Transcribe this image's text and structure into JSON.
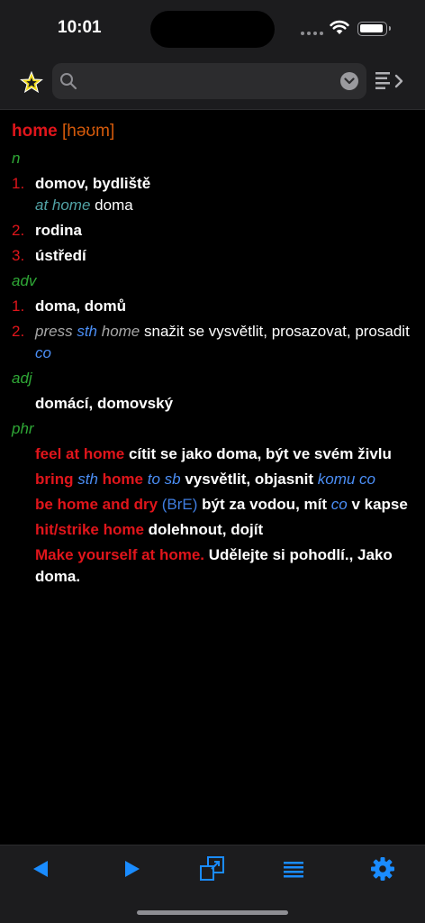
{
  "status": {
    "time": "10:01"
  },
  "search": {
    "placeholder": "",
    "value": ""
  },
  "entry": {
    "headword": "home",
    "pronunciation": "[həʊm]",
    "noun": {
      "pos": "n",
      "senses": [
        {
          "num": "1.",
          "translation": "domov, bydliště",
          "example": "at home",
          "example_translation": "doma"
        },
        {
          "num": "2.",
          "translation": "rodina"
        },
        {
          "num": "3.",
          "translation": "ústředí"
        }
      ]
    },
    "adverb": {
      "pos": "adv",
      "sense1": {
        "num": "1.",
        "translation": "doma, domů"
      },
      "sense2": {
        "num": "2.",
        "press": "press",
        "sth": "sth",
        "home": "home",
        "translation": "snažit se vysvětlit, prosazovat, prosadit",
        "co": "co"
      }
    },
    "adjective": {
      "pos": "adj",
      "translation": "domácí, domovský"
    },
    "phrases": {
      "pos": "phr",
      "p1": {
        "phrase": "feel at home",
        "translation": "cítit se jako doma, být ve svém živlu"
      },
      "p2": {
        "bring": "bring",
        "sth": "sth",
        "home": "home",
        "to_sb": "to sb",
        "translation": "vysvětlit, objasnit",
        "komu": "komu",
        "co": "co"
      },
      "p3": {
        "phrase": "be home and dry",
        "region": "(BrE)",
        "translation_a": "být za vodou, mít",
        "co": "co",
        "translation_b": "v kapse"
      },
      "p4": {
        "phrase": "hit/strike home",
        "translation": "dolehnout, dojít"
      },
      "p5": {
        "phrase": "Make yourself at home.",
        "translation": "Udělejte si pohodlí., Jako doma."
      }
    }
  },
  "colors": {
    "headword": "#e0151b",
    "pronunciation": "#d55a0b",
    "pos": "#2fa836",
    "example": "#52a3a6",
    "accent_blue": "#1a8cff"
  },
  "icons": {
    "favorite": "star-icon",
    "search": "search-icon",
    "dropdown": "chevron-down-icon",
    "list_toggle": "list-arrow-icon",
    "back": "back-arrow-icon",
    "forward": "forward-arrow-icon",
    "windows": "windows-icon",
    "list": "list-icon",
    "settings": "gear-icon"
  }
}
